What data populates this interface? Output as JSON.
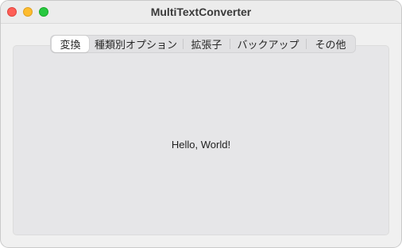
{
  "window": {
    "title": "MultiTextConverter"
  },
  "traffic_lights": {
    "close_color": "#fe5f57",
    "minimize_color": "#febc2e",
    "zoom_color": "#28c840"
  },
  "tabs": [
    {
      "label": "変換",
      "selected": true
    },
    {
      "label": "種類別オプション",
      "selected": false
    },
    {
      "label": "拡張子",
      "selected": false
    },
    {
      "label": "バックアップ",
      "selected": false
    },
    {
      "label": "その他",
      "selected": false
    }
  ],
  "content": {
    "message": "Hello, World!"
  }
}
